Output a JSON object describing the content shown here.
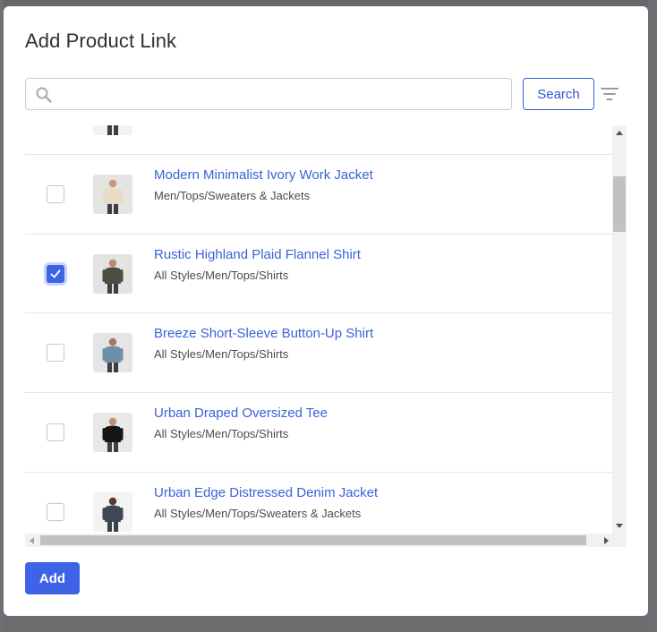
{
  "dialog": {
    "title": "Add Product Link"
  },
  "search": {
    "value": "",
    "placeholder": "",
    "button_label": "Search",
    "icon": "search-icon",
    "filter_icon": "filter-icon"
  },
  "products": [
    {
      "title": "",
      "path": "",
      "checked": false,
      "thumb_colors": {
        "bg": "#f2f2f2",
        "garment": "#1c1c1c",
        "skin": "#c99b7e"
      }
    },
    {
      "title": "Modern Minimalist Ivory Work Jacket",
      "path": "Men/Tops/Sweaters & Jackets",
      "checked": false,
      "thumb_colors": {
        "bg": "#e6e4e1",
        "garment": "#e8dcc7",
        "skin": "#c9997b"
      }
    },
    {
      "title": "Rustic Highland Plaid Flannel Shirt",
      "path": "All Styles/Men/Tops/Shirts",
      "checked": true,
      "thumb_colors": {
        "bg": "#e3e3e1",
        "garment": "#4a5040",
        "skin": "#b98a6c"
      }
    },
    {
      "title": "Breeze Short-Sleeve Button-Up Shirt",
      "path": "All Styles/Men/Tops/Shirts",
      "checked": false,
      "thumb_colors": {
        "bg": "#e5e5e5",
        "garment": "#6f8fa8",
        "skin": "#a8775b"
      }
    },
    {
      "title": "Urban Draped Oversized Tee",
      "path": "All Styles/Men/Tops/Shirts",
      "checked": false,
      "thumb_colors": {
        "bg": "#e8e8e8",
        "garment": "#161616",
        "skin": "#c09074"
      }
    },
    {
      "title": "Urban Edge Distressed Denim Jacket",
      "path": "All Styles/Men/Tops/Sweaters & Jackets",
      "checked": false,
      "thumb_colors": {
        "bg": "#f3f3f3",
        "garment": "#3f4654",
        "skin": "#5a3a28"
      }
    }
  ],
  "footer": {
    "add_label": "Add"
  },
  "colors": {
    "accent": "#3e63e6",
    "link": "#3a62d8",
    "overlay": "#6b6c70"
  }
}
